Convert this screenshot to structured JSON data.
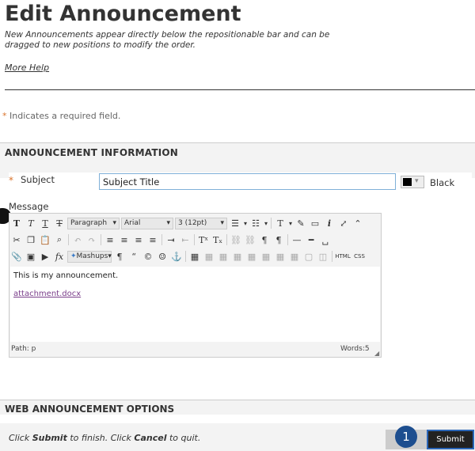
{
  "header": {
    "title": "Edit Announcement",
    "subtitle": "New Announcements appear directly below the repositionable bar and can be dragged to new positions to modify the order.",
    "more_help": "More Help"
  },
  "required_note": {
    "star": "*",
    "text": "Indicates a required field."
  },
  "announcement_info": {
    "section_title": "ANNOUNCEMENT INFORMATION",
    "subject_label": "Subject",
    "subject_value": "Subject Title",
    "color_name": "Black",
    "message_label": "Message"
  },
  "editor": {
    "paragraph_select": "Paragraph",
    "font_select": "Arial",
    "size_select": "3 (12pt)",
    "mashups_label": "Mashups",
    "html_label": "HTML",
    "css_label": "CSS",
    "content_text": "This is my announcement.",
    "attachment": "attachment.docx",
    "path": "Path: p",
    "word_count": "Words:5"
  },
  "web_options": {
    "section_title": "WEB ANNOUNCEMENT OPTIONS"
  },
  "footer": {
    "instruction_parts": [
      "Click ",
      "Submit",
      " to finish. Click ",
      "Cancel",
      " to quit."
    ],
    "step_number": "1",
    "submit_label": "Submit"
  }
}
